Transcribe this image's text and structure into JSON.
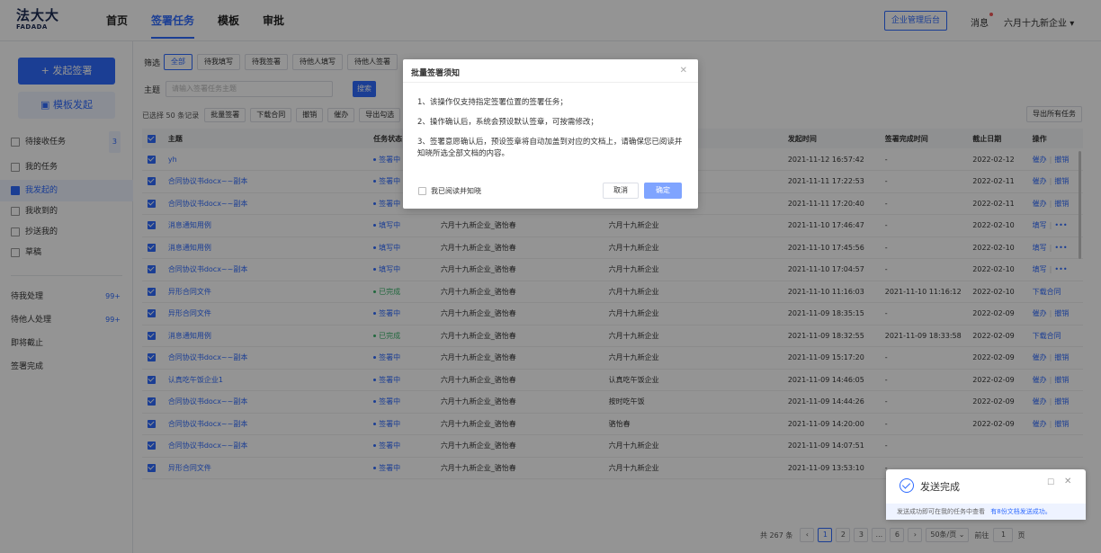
{
  "brand": {
    "cn": "法大大",
    "en": "FADADA"
  },
  "nav": [
    {
      "label": "首页",
      "active": false
    },
    {
      "label": "签署任务",
      "active": true
    },
    {
      "label": "模板",
      "active": false
    },
    {
      "label": "审批",
      "active": false
    }
  ],
  "header": {
    "admin": "企业管理后台",
    "messages": "消息",
    "company": "六月十九新企业"
  },
  "sidebar": {
    "start_sign": "+ 发起签署",
    "template_sign": "模板发起",
    "pending_receive": {
      "label": "待接收任务",
      "count": "3"
    },
    "my_tasks": "我的任务",
    "items": [
      {
        "label": "我发起的",
        "active": true
      },
      {
        "label": "我收到的",
        "active": false
      },
      {
        "label": "抄送我的",
        "active": false
      },
      {
        "label": "草稿",
        "active": false
      }
    ],
    "groups": [
      {
        "label": "待我处理",
        "count": "99+"
      },
      {
        "label": "待他人处理",
        "count": "99+"
      },
      {
        "label": "即将截止",
        "count": ""
      },
      {
        "label": "签署完成",
        "count": ""
      }
    ]
  },
  "filters": {
    "label": "筛选",
    "chips": [
      {
        "label": "全部",
        "active": true
      },
      {
        "label": "待我填写",
        "active": false
      },
      {
        "label": "待我签署",
        "active": false
      },
      {
        "label": "待他人填写",
        "active": false
      },
      {
        "label": "待他人签署",
        "active": false
      }
    ]
  },
  "search": {
    "label": "主题",
    "placeholder": "请输入签署任务主题",
    "button": "搜索"
  },
  "actions": {
    "selected": "已选择 50 条记录",
    "buttons": [
      "批量签署",
      "下载合同",
      "撤销",
      "催办",
      "导出勾选"
    ],
    "export_all": "导出所有任务"
  },
  "table": {
    "columns": [
      "主题",
      "任务状态",
      "发起人",
      "参与方",
      "发起时间",
      "签署完成时间",
      "截止日期",
      "操作"
    ],
    "rows": [
      {
        "subject": "yh",
        "status": "签署中",
        "initiator": "",
        "party": "",
        "created": "2021-11-12 16:57:42",
        "completed": "-",
        "deadline": "2022-02-12",
        "ops": [
          "催办",
          "撤销"
        ]
      },
      {
        "subject": "合同协议书docx~~副本",
        "status": "签署中",
        "initiator": "",
        "party": "",
        "created": "2021-11-11 17:22:53",
        "completed": "-",
        "deadline": "2022-02-11",
        "ops": [
          "催办",
          "撤销"
        ]
      },
      {
        "subject": "合同协议书docx~~副本",
        "status": "签署中",
        "initiator": "六月十九新企业_骆怡春",
        "party": "华孝科技",
        "created": "2021-11-11 17:20:40",
        "completed": "-",
        "deadline": "2022-02-11",
        "ops": [
          "催办",
          "撤销"
        ]
      },
      {
        "subject": "消息通知用例",
        "status": "填写中",
        "initiator": "六月十九新企业_骆怡春",
        "party": "六月十九新企业",
        "created": "2021-11-10 17:46:47",
        "completed": "-",
        "deadline": "2022-02-10",
        "ops": [
          "填写",
          "•••"
        ]
      },
      {
        "subject": "消息通知用例",
        "status": "填写中",
        "initiator": "六月十九新企业_骆怡春",
        "party": "六月十九新企业",
        "created": "2021-11-10 17:45:56",
        "completed": "-",
        "deadline": "2022-02-10",
        "ops": [
          "填写",
          "•••"
        ]
      },
      {
        "subject": "合同协议书docx~~副本",
        "status": "填写中",
        "initiator": "六月十九新企业_骆怡春",
        "party": "六月十九新企业",
        "created": "2021-11-10 17:04:57",
        "completed": "-",
        "deadline": "2022-02-10",
        "ops": [
          "填写",
          "•••"
        ]
      },
      {
        "subject": "异形合同文件",
        "status": "已完成",
        "initiator": "六月十九新企业_骆怡春",
        "party": "六月十九新企业",
        "created": "2021-11-10 11:16:03",
        "completed": "2021-11-10 11:16:12",
        "deadline": "2022-02-10",
        "ops": [
          "下载合同"
        ]
      },
      {
        "subject": "异形合同文件",
        "status": "签署中",
        "initiator": "六月十九新企业_骆怡春",
        "party": "六月十九新企业",
        "created": "2021-11-09 18:35:15",
        "completed": "-",
        "deadline": "2022-02-09",
        "ops": [
          "催办",
          "撤销"
        ]
      },
      {
        "subject": "消息通知用例",
        "status": "已完成",
        "initiator": "六月十九新企业_骆怡春",
        "party": "六月十九新企业",
        "created": "2021-11-09 18:32:55",
        "completed": "2021-11-09 18:33:58",
        "deadline": "2022-02-09",
        "ops": [
          "下载合同"
        ]
      },
      {
        "subject": "合同协议书docx~~副本",
        "status": "签署中",
        "initiator": "六月十九新企业_骆怡春",
        "party": "六月十九新企业",
        "created": "2021-11-09 15:17:20",
        "completed": "-",
        "deadline": "2022-02-09",
        "ops": [
          "催办",
          "撤销"
        ]
      },
      {
        "subject": "认真吃午饭企业1",
        "status": "签署中",
        "initiator": "六月十九新企业_骆怡春",
        "party": "认真吃午饭企业",
        "created": "2021-11-09 14:46:05",
        "completed": "-",
        "deadline": "2022-02-09",
        "ops": [
          "催办",
          "撤销"
        ]
      },
      {
        "subject": "合同协议书docx~~副本",
        "status": "签署中",
        "initiator": "六月十九新企业_骆怡春",
        "party": "按时吃午饭",
        "created": "2021-11-09 14:44:26",
        "completed": "-",
        "deadline": "2022-02-09",
        "ops": [
          "催办",
          "撤销"
        ]
      },
      {
        "subject": "合同协议书docx~~副本",
        "status": "签署中",
        "initiator": "六月十九新企业_骆怡春",
        "party": "骆怡春",
        "created": "2021-11-09 14:20:00",
        "completed": "-",
        "deadline": "2022-02-09",
        "ops": [
          "催办",
          "撤销"
        ]
      },
      {
        "subject": "合同协议书docx~~副本",
        "status": "签署中",
        "initiator": "六月十九新企业_骆怡春",
        "party": "六月十九新企业",
        "created": "2021-11-09 14:07:51",
        "completed": "-",
        "deadline": "",
        "ops": []
      },
      {
        "subject": "异形合同文件",
        "status": "签署中",
        "initiator": "六月十九新企业_骆怡春",
        "party": "六月十九新企业",
        "created": "2021-11-09 13:53:10",
        "completed": "-",
        "deadline": "",
        "ops": []
      }
    ]
  },
  "status_colors": {
    "签署中": "#2f6bff",
    "填写中": "#2f6bff",
    "已完成": "#3bb36b"
  },
  "pagination": {
    "total": "共 267 条",
    "pages": [
      "1",
      "2",
      "3",
      "...",
      "6"
    ],
    "current": "1",
    "size": "50条/页",
    "goto_label": "前往",
    "goto_value": "1",
    "page_suffix": "页"
  },
  "modal": {
    "title": "批量签署须知",
    "lines": [
      "1、该操作仅支持指定签署位置的签署任务；",
      "2、操作确认后，系统会预设默认签章，可按需修改；",
      "3、签署意愿确认后，预设签章将自动加盖到对应的文档上，请确保您已阅读并知晓所选全部文档的内容。"
    ],
    "agree": "我已阅读并知晓",
    "cancel": "取消",
    "confirm": "确定"
  },
  "toast": {
    "title": "发送完成",
    "message": "发送成功即可在我的任务中查看",
    "link": "有8份文档发送成功。"
  }
}
